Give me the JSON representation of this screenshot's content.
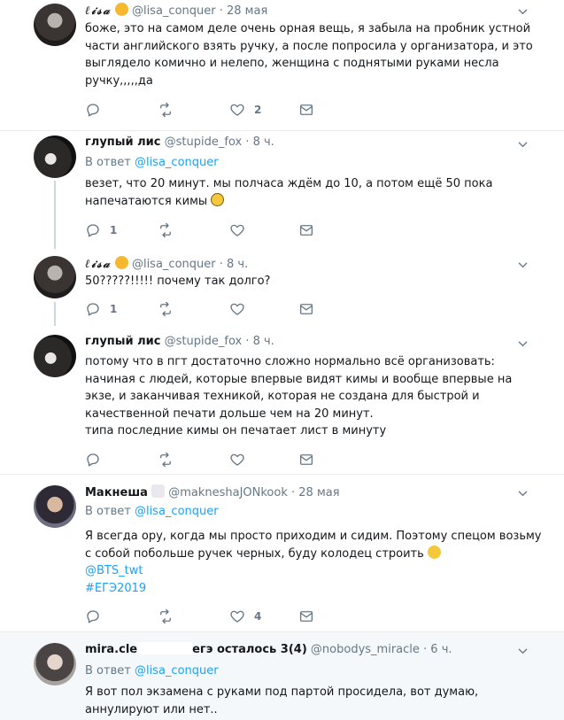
{
  "tweets": [
    {
      "name": "ℓ𝒾𝓈𝒶",
      "handle": "@lisa_conquer",
      "time": "· 28 мая",
      "text": "боже, это на самом деле очень орная вещь, я забыла на пробник устной части английского взять ручку, а после попросила у организатора, и это выглядело комично и нелепо, женщина с поднятыми руками несла ручку,,,,,да",
      "reply_count": "",
      "retweet_count": "",
      "like_count": "2"
    },
    {
      "name": "глупый лис",
      "handle": "@stupide_fox",
      "time": "· 8 ч.",
      "reply_prefix": "В ответ",
      "reply_link": "@lisa_conquer",
      "text": "везет, что 20 минут. мы полчаса ждём до 10, а потом ещё 50 пока напечатаются кимы",
      "reply_count": "1",
      "retweet_count": "",
      "like_count": ""
    },
    {
      "name": "ℓ𝒾𝓈𝒶",
      "handle": "@lisa_conquer",
      "time": "· 8 ч.",
      "text": "50?????!!!!! почему так долго?",
      "reply_count": "1",
      "retweet_count": "",
      "like_count": ""
    },
    {
      "name": "глупый лис",
      "handle": "@stupide_fox",
      "time": "· 8 ч.",
      "text_lines": [
        "потому что в пгт достаточно сложно нормально всё организовать: начиная с людей, которые впервые видят кимы и вообще впервые на экзе, и заканчивая техникой, которая не создана для быстрой и качественной печати дольше чем на 20 минут.",
        "типа последние кимы он печатает лист в минуту"
      ],
      "reply_count": "",
      "retweet_count": "",
      "like_count": ""
    },
    {
      "name": "Макнеша",
      "handle": "@makneshaJONkook",
      "time": "· 28 мая",
      "reply_prefix": "В ответ",
      "reply_link": "@lisa_conquer",
      "text": "Я всегда ору, когда мы просто приходим и сидим. Поэтому спецом возьму с собой побольше ручек черных, буду колодец строить",
      "link1": "@BTS_twt",
      "link2": "#ЕГЭ2019",
      "reply_count": "",
      "retweet_count": "",
      "like_count": "4"
    },
    {
      "name_start": "mira.cle",
      "name_end": "егэ осталось 3(4)",
      "handle": "@nobodys_miracle",
      "time": "· 6 ч.",
      "reply_prefix": "В ответ",
      "reply_link": "@lisa_conquer",
      "text": "Я вот пол экзамена с руками под партой просидела, вот думаю, аннулируют или нет.."
    }
  ],
  "colors": {
    "accent": "#1da1f2",
    "muted": "#657786",
    "text": "#14171a",
    "thread_line": "#ccd6dd",
    "highlight_bg": "#f5f8fa"
  },
  "icons": [
    "reply-icon",
    "retweet-icon",
    "like-icon",
    "dm-icon",
    "chevron-down-icon"
  ]
}
